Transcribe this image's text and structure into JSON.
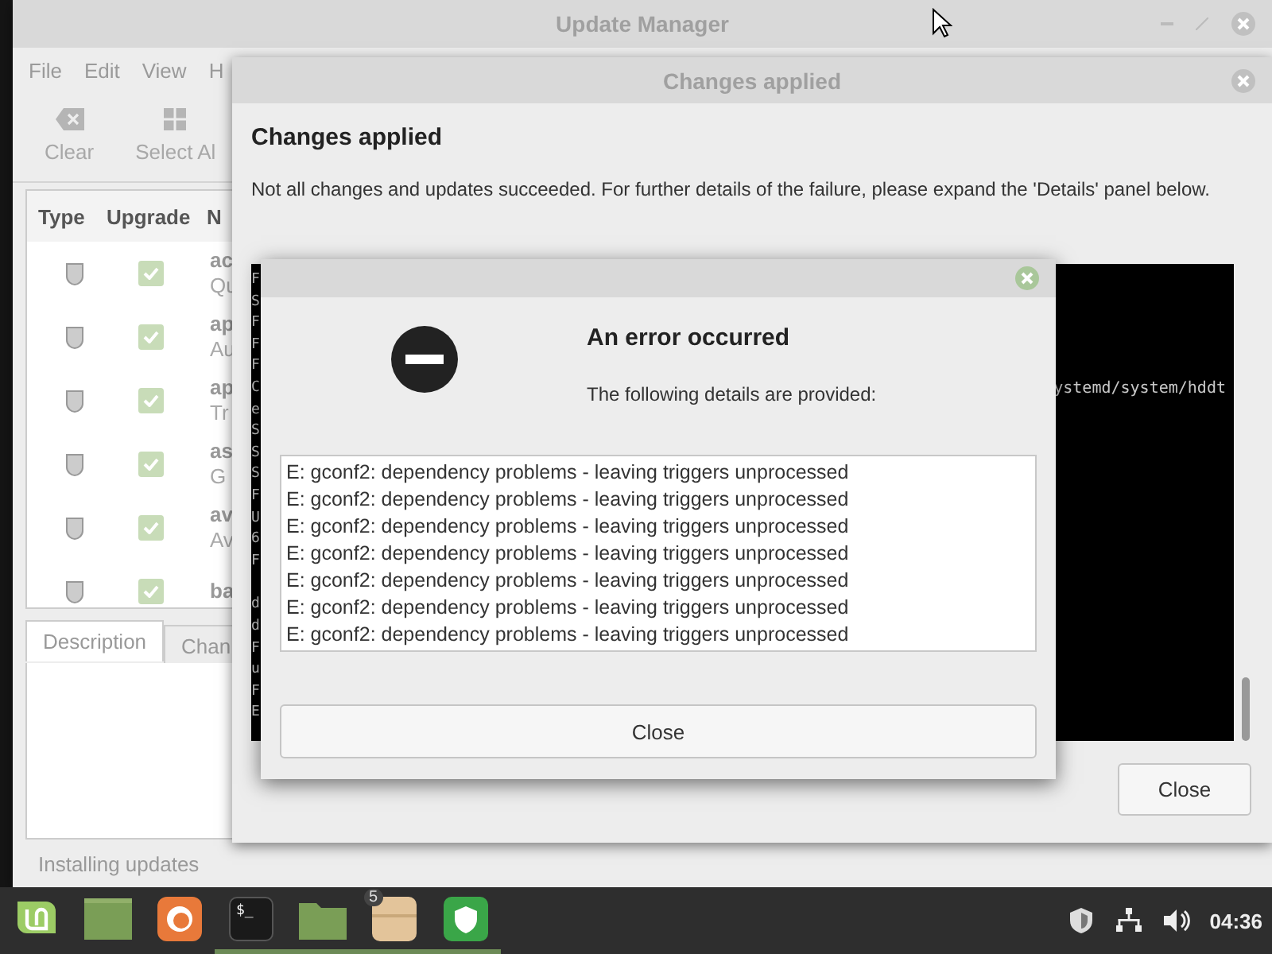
{
  "main_window": {
    "title": "Update Manager",
    "menu": [
      "File",
      "Edit",
      "View",
      "H"
    ],
    "toolbar": [
      {
        "label": "Clear",
        "kind": "clear"
      },
      {
        "label": "Select Al",
        "kind": "select"
      }
    ],
    "table": {
      "columns": [
        "Type",
        "Upgrade",
        "N"
      ],
      "rows": [
        {
          "name": "ac",
          "description": "Qu",
          "checked": true
        },
        {
          "name": "ap",
          "description": "Au",
          "checked": true
        },
        {
          "name": "ap",
          "description": "Tr",
          "checked": true
        },
        {
          "name": "as",
          "description": "G",
          "checked": true
        },
        {
          "name": "av",
          "description": "Av",
          "checked": true
        },
        {
          "name": "ba",
          "checked": true
        }
      ]
    },
    "tabs": [
      {
        "label": "Description",
        "selected": true
      },
      {
        "label": "Chan",
        "selected": false
      }
    ],
    "status": "Installing updates"
  },
  "changes_dialog": {
    "title": "Changes applied",
    "heading": "Changes applied",
    "message": "Not all changes and updates succeeded. For further details of the failure, please expand the 'Details' panel below.",
    "terminal_lines": [
      {
        "start": "F"
      },
      {
        "start": "S"
      },
      {
        "start": "F"
      },
      {
        "start": "F"
      },
      {
        "start": "F"
      },
      {
        "start": "C",
        "end": "ystemd/system/hddt"
      },
      {
        "start": "e"
      },
      {
        "start": "S"
      },
      {
        "start": "S"
      },
      {
        "start": "S"
      },
      {
        "start": "F"
      },
      {
        "start": "U"
      },
      {
        "start": "6"
      },
      {
        "start": "F"
      },
      {
        "start": "d",
        "gap_before": true
      },
      {
        "start": "d"
      },
      {
        "start": "F"
      },
      {
        "start": "u"
      },
      {
        "start": "F"
      },
      {
        "start": "E"
      }
    ],
    "close_button": "Close"
  },
  "error_dialog": {
    "heading": "An error occurred",
    "subheading": "The following details are provided:",
    "details": [
      "E: gconf2: dependency problems - leaving triggers unprocessed",
      "E: gconf2: dependency problems - leaving triggers unprocessed",
      "E: gconf2: dependency problems - leaving triggers unprocessed",
      "E: gconf2: dependency problems - leaving triggers unprocessed",
      "E: gconf2: dependency problems - leaving triggers unprocessed",
      "E: gconf2: dependency problems - leaving triggers unprocessed",
      "E: gconf2: dependency problems - leaving triggers unprocessed"
    ],
    "close_button": "Close"
  },
  "taskbar": {
    "apps": [
      {
        "kind": "menu",
        "running": false
      },
      {
        "kind": "window",
        "running": false
      },
      {
        "kind": "browser",
        "running": false
      },
      {
        "kind": "terminal",
        "running": true,
        "label": "$_"
      },
      {
        "kind": "folder",
        "running": true
      },
      {
        "kind": "package",
        "running": true,
        "badge": "5"
      },
      {
        "kind": "shield",
        "running": true
      }
    ],
    "tray": [
      {
        "kind": "shield"
      },
      {
        "kind": "network"
      },
      {
        "kind": "volume"
      }
    ],
    "clock": "04:36"
  }
}
